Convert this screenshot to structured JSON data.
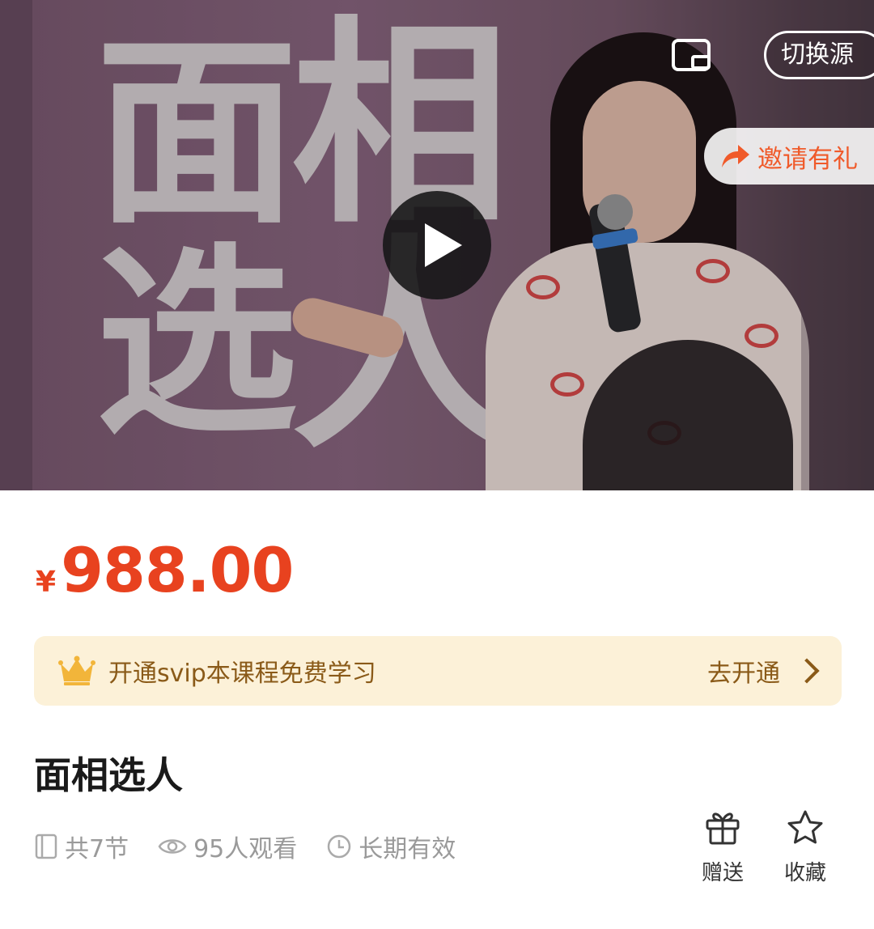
{
  "video": {
    "background_text": [
      "面",
      "相",
      "选",
      "人"
    ],
    "switch_source_label": "切换源",
    "invite_label": "邀请有礼",
    "icons": {
      "pip": "picture-in-picture-icon",
      "share": "share-arrow-icon",
      "play": "play-icon"
    }
  },
  "price": {
    "currency": "¥",
    "amount": "988.00",
    "color": "#e8421f"
  },
  "svip_banner": {
    "text": "开通svip本课程免费学习",
    "action_label": "去开通",
    "icon": "crown-icon",
    "background": "#fcf1d8"
  },
  "course": {
    "title": "面相选人",
    "meta": {
      "lessons": "共7节",
      "views": "95人观看",
      "validity": "长期有效"
    }
  },
  "actions": {
    "gift_label": "赠送",
    "favorite_label": "收藏"
  }
}
